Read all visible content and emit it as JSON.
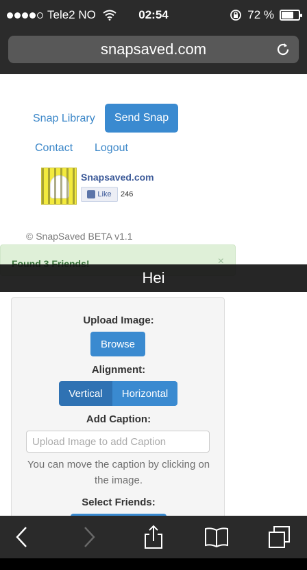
{
  "status_bar": {
    "carrier": "Tele2 NO",
    "time": "02:54",
    "battery": "72 %",
    "battery_level": 0.72
  },
  "browser": {
    "url": "snapsaved.com"
  },
  "nav": {
    "snap_library": "Snap Library",
    "send_snap": "Send Snap",
    "contact": "Contact",
    "logout": "Logout"
  },
  "facebook": {
    "page_name": "Snapsaved.com",
    "like_label": "Like",
    "like_count": "246"
  },
  "footer": {
    "copyright": "© SnapSaved BETA v1.1"
  },
  "alert": {
    "message": "Found 3 Friends!",
    "close": "×"
  },
  "snap_caption_overlay": "Hei",
  "form": {
    "upload_label": "Upload Image:",
    "browse_label": "Browse",
    "alignment_label": "Alignment:",
    "vertical_label": "Vertical",
    "horizontal_label": "Horizontal",
    "caption_label": "Add Caption:",
    "caption_placeholder": "Upload Image to add Caption",
    "help_text": "You can move the caption by clicking on the image.",
    "friends_label": "Select Friends:"
  },
  "icons": [
    "wifi-icon",
    "rotation-lock-icon",
    "battery-icon",
    "reload-icon",
    "back-icon",
    "forward-icon",
    "share-icon",
    "bookmarks-icon",
    "tabs-icon"
  ]
}
